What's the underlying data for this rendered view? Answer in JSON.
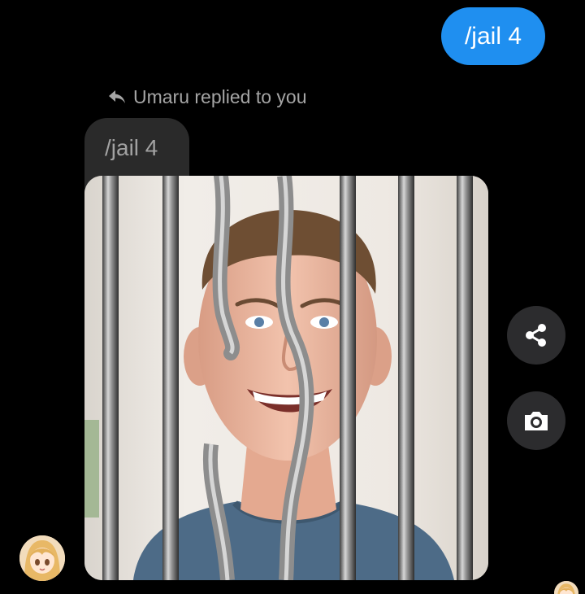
{
  "conversation": {
    "sent_message": {
      "text": "/jail 4",
      "color": "#1f8ff0"
    },
    "reply_indicator": {
      "icon": "reply-arrow-icon",
      "text": "Umaru replied to you"
    },
    "quoted_message": {
      "text": "/jail 4"
    },
    "image_message": {
      "description_icon": "photo-of-smiling-man-behind-bent-jail-bars"
    },
    "actions": [
      {
        "icon": "share-icon"
      },
      {
        "icon": "camera-icon"
      }
    ],
    "sender_avatar": {
      "icon": "anime-girl-avatar"
    }
  },
  "colors": {
    "background": "#000000",
    "sent_bubble": "#1f8ff0",
    "received_bubble": "#2a2a2a",
    "secondary_text": "#a5a5a5",
    "action_button": "#2c2c2e"
  }
}
